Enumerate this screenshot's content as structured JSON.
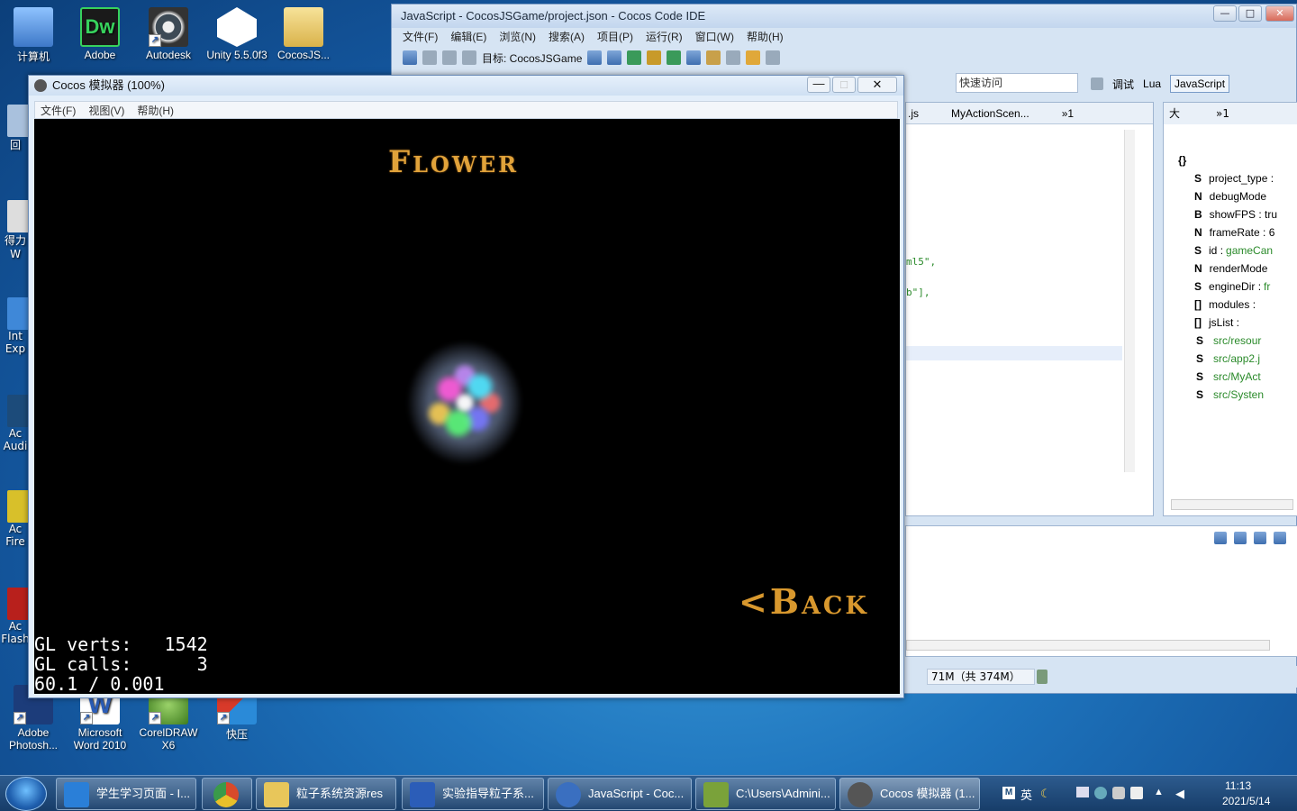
{
  "desktop": {
    "icons": [
      {
        "label": "计算机",
        "color": "#5a8fd0"
      },
      {
        "label": "Adobe\nD...",
        "color": "#2a2a2a",
        "badge": "Dw",
        "badge_color": "#37d25d"
      },
      {
        "label": "Autodesk\n3ds Max...",
        "color": "#3d4a55"
      },
      {
        "label": "Unity 5.5.0f3\n(64-bit)",
        "color": "#2a2a2a"
      },
      {
        "label": "CocosJS...",
        "color": "#e8c65a"
      },
      {
        "label": "回",
        "color": "#9fb8d8"
      },
      {
        "label": "得力\nW",
        "color": "#c8c8c8"
      },
      {
        "label": "Int\nExp",
        "color": "#3f88d8"
      },
      {
        "label": "Ac\nAudi",
        "color": "#1c4b7a"
      },
      {
        "label": "Ac\nFire",
        "color": "#d8c02a"
      },
      {
        "label": "Ac\nFlash",
        "color": "#b8201c"
      },
      {
        "label": "Adobe\nPhotosh...",
        "color": "#1c3c7a"
      },
      {
        "label": "Microsoft\nWord 2010",
        "color": "#2b5db8"
      },
      {
        "label": "CorelDRAW\nX6",
        "color": "#5aa02a"
      },
      {
        "label": "快压",
        "color": "#d83a2a"
      }
    ]
  },
  "ide": {
    "title": "JavaScript - CocosJSGame/project.json - Cocos Code IDE",
    "menu": [
      "文件(F)",
      "编辑(E)",
      "浏览(N)",
      "搜索(A)",
      "项目(P)",
      "运行(R)",
      "窗口(W)",
      "帮助(H)"
    ],
    "target_label": "目标: CocosJSGame",
    "quick_access": "快速访问",
    "perspectives": [
      "调试",
      "Lua",
      "JavaScript"
    ],
    "editor_tabs": [
      ".js",
      "MyActionScen...",
      "»1"
    ],
    "code_fragments": [
      "ml5\",",
      "b\"],"
    ],
    "outline_tab": "大",
    "outline_tab_more": "»1",
    "outline": [
      {
        "type": "{}",
        "key": "",
        "value": ""
      },
      {
        "type": "S",
        "key": "project_type :",
        "value": ""
      },
      {
        "type": "N",
        "key": "debugMode",
        "value": ""
      },
      {
        "type": "B",
        "key": "showFPS : tru",
        "value": ""
      },
      {
        "type": "N",
        "key": "frameRate : 6",
        "value": ""
      },
      {
        "type": "S",
        "key": "id :",
        "value": "gameCan"
      },
      {
        "type": "N",
        "key": "renderMode",
        "value": ""
      },
      {
        "type": "S",
        "key": "engineDir :",
        "value": "fr"
      },
      {
        "type": "[]",
        "key": "modules :",
        "value": ""
      },
      {
        "type": "[]",
        "key": "jsList :",
        "value": ""
      },
      {
        "type": "S",
        "key": "",
        "value": "src/resour"
      },
      {
        "type": "S",
        "key": "",
        "value": "src/app2.j"
      },
      {
        "type": "S",
        "key": "",
        "value": "src/MyAct"
      },
      {
        "type": "S",
        "key": "",
        "value": "src/Systen"
      }
    ],
    "memory": "71M（共 374M）"
  },
  "simulator": {
    "title": "Cocos 模拟器 (100%)",
    "menu": [
      "文件(F)",
      "视图(V)",
      "帮助(H)"
    ],
    "scene_title": "Flower",
    "back_label": "<Back",
    "stats": "GL verts:   1542\nGL calls:      3\n60.1 / 0.001"
  },
  "taskbar": {
    "tasks": [
      {
        "label": "学生学习页面 - I...",
        "color": "#2a7fd8"
      },
      {
        "label": "",
        "color": "#d84a2a"
      },
      {
        "label": "粒子系统资源res",
        "color": "#e8c65a"
      },
      {
        "label": "实验指导粒子系...",
        "color": "#2b5db8"
      },
      {
        "label": "JavaScript - Coc...",
        "color": "#3a6fc0"
      },
      {
        "label": "C:\\Users\\Admini...",
        "color": "#7aa23a"
      },
      {
        "label": "Cocos 模拟器 (1...",
        "color": "#555"
      }
    ],
    "tray_text": "英",
    "time": "11:13",
    "date": "2021/5/14"
  }
}
